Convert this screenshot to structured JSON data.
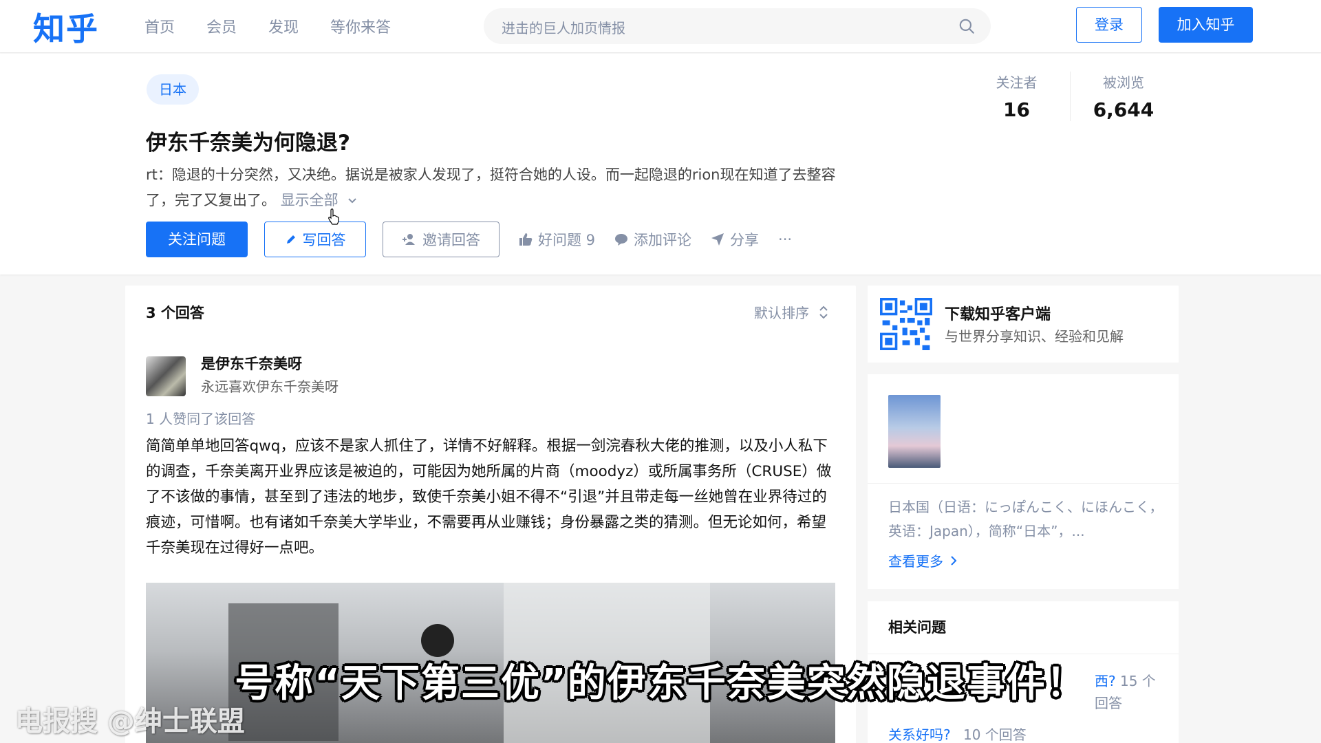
{
  "topbar": {
    "logo": "知乎",
    "nav": [
      "首页",
      "会员",
      "发现",
      "等你来答"
    ],
    "search_placeholder": "进击的巨人加页情报",
    "login_label": "登录",
    "join_label": "加入知乎"
  },
  "question": {
    "tag": "日本",
    "title": "伊东千奈美为何隐退?",
    "description": "rt：隐退的十分突然，又决绝。据说是被家人发现了，挺符合她的人设。而一起隐退的rion现在知道了去整容了，完了又复出了。",
    "show_all": "显示全部",
    "stats": {
      "followers_label": "关注者",
      "followers_value": "16",
      "views_label": "被浏览",
      "views_value": "6,644"
    },
    "actions": {
      "follow": "关注问题",
      "write": "写回答",
      "invite": "邀请回答",
      "good_question": "好问题 9",
      "comment": "添加评论",
      "share": "分享",
      "more": "···"
    }
  },
  "answers": {
    "header": "3 个回答",
    "sort_label": "默认排序",
    "first": {
      "author": "是伊东千奈美呀",
      "bio": "永远喜欢伊东千奈美呀",
      "votes": "1 人赞同了该回答",
      "content": "简简单单地回答qwq，应该不是家人抓住了，详情不好解释。根据一剑浣春秋大佬的推测，以及小人私下的调查，千奈美离开业界应该是被迫的，可能因为她所属的片商（moodyz）或所属事务所（CRUSE）做了不该做的事情，甚至到了违法的地步，致使千奈美小姐不得不“引退”并且带走每一丝她曾在业界待过的痕迹，可惜啊。也有诸如千奈美大学毕业，不需要再从业赚钱；身份暴露之类的猜测。但无论如何，希望千奈美现在过得好一点吧。"
    }
  },
  "sidebar": {
    "download": {
      "title": "下载知乎客户端",
      "subtitle": "与世界分享知识、经验和见解"
    },
    "topic": {
      "description": "日本国（日语：にっぽんこく、にほんこく，英语：Japan），简称“日本”，...",
      "more_link": "查看更多"
    },
    "related": {
      "title": "相关问题",
      "q1_text": "西?",
      "q1_count": "15 个回答",
      "q2_text": "关系好吗?",
      "q2_count": "10 个回答"
    }
  },
  "overlay": {
    "caption": "号称“天下第三优”的伊东千奈美突然隐退事件！",
    "watermark": "电报搜 @绅士联盟"
  },
  "colors": {
    "brand": "#1772f6",
    "muted": "#8590a6"
  }
}
